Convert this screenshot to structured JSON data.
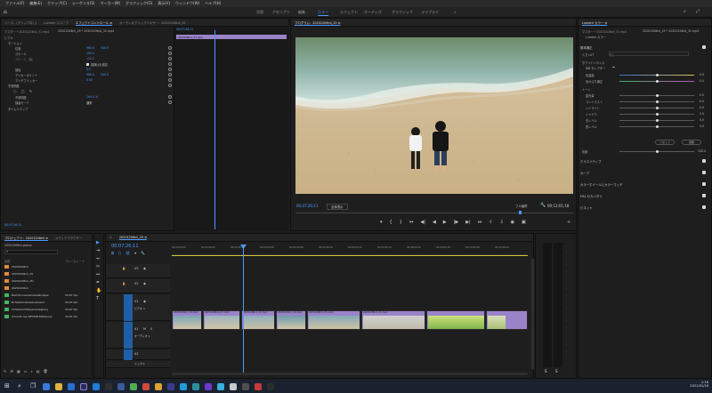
{
  "menu": [
    "ファイル(F)",
    "編集(E)",
    "クリップ(C)",
    "シーケンス(S)",
    "マーカー(M)",
    "グラフィック(G)",
    "表示(V)",
    "ウィンドウ(W)",
    "ヘルプ(H)"
  ],
  "workspaces": [
    "学習",
    "アセンブリ",
    "編集",
    "カラー",
    "エフェクト",
    "オーディオ",
    "グラフィック",
    "ライブラリ"
  ],
  "active_workspace": "カラー",
  "source_tabs": [
    "ソース：(クリップなし)",
    "Lumetri スコープ",
    "エフェクトコントロール ≡",
    "オーディオクリップミキサー：20201206nii_25"
  ],
  "effect_controls": {
    "header_left": "マスター * 20201206nii_31.mp4",
    "header_right": "20201206nii_25 * 20201206nii_31.mp4",
    "section_video": "ビデオ",
    "motion": "モーション",
    "rows": [
      {
        "label": "位置",
        "val1": "960.0",
        "val2": "540.0"
      },
      {
        "label": "スケール",
        "val1": "100.0",
        "val2": ""
      },
      {
        "label": "スケール（幅）",
        "val1": "100.0",
        "val2": ""
      },
      {
        "label": "",
        "val1": "",
        "val2": "縦横比を固定"
      },
      {
        "label": "回転",
        "val1": "0.0",
        "val2": ""
      },
      {
        "label": "アンカーポイント",
        "val1": "960.0",
        "val2": "540.0"
      },
      {
        "label": "アンチフリッカー",
        "val1": "0.00",
        "val2": ""
      }
    ],
    "opacity": "不透明度",
    "opacity_val": "100.0 %",
    "blend_label": "描画モード",
    "blend_val": "通常",
    "timeremap": "タイムリマップ",
    "tc_mini": "00;07;26;11",
    "clip_name": "20201206nii_31.mp4"
  },
  "program": {
    "tab": "プログラム：20201206nii_25 ≡",
    "timecode": "00;07;26;11",
    "fit": "全体表示",
    "quality": "フル画質",
    "duration": "00;12;01;18",
    "controls": [
      "⏮",
      "◀|",
      "◀",
      "▶",
      "|▶",
      "▶|",
      "⏭"
    ]
  },
  "lumetri": {
    "tab": "Lumetri カラー ≡",
    "header_left": "マスター * 20201206nii_31.mp4",
    "header_right": "20201206nii_25 * 20201206nii_31.mp4",
    "preset": "Lumetri カラー",
    "basic": "基本補正",
    "input_lut_label": "入力 LUT",
    "input_lut_val": "なし",
    "wb_label": "ホワイトバランス",
    "wb_picker": "WB セレクター",
    "temp_label": "色温度",
    "temp_val": "0.0",
    "tint_label": "色かぶり補正",
    "tint_val": "0.0",
    "tone_label": "トーン",
    "tone_rows": [
      {
        "label": "露光量",
        "val": "0.0"
      },
      {
        "label": "コントラスト",
        "val": "0.0"
      },
      {
        "label": "ハイライト",
        "val": "0.0"
      },
      {
        "label": "シャドウ",
        "val": "0.0"
      },
      {
        "label": "白レベル",
        "val": "0.0"
      },
      {
        "label": "黒レベル",
        "val": "0.0"
      }
    ],
    "reset_btn": "リセット",
    "auto_btn": "自動",
    "sat_label": "彩度",
    "sat_val": "100.0",
    "sections": [
      "クリエイティブ",
      "カーブ",
      "カラーホイールとカラーマッチ",
      "HSL セカンダリ",
      "ビネット"
    ]
  },
  "project": {
    "tab": "プロジェクト：20201206nii ≡",
    "tab2": "メディアブラウザー",
    "file": "20201206nii.prproj",
    "col_name": "名前",
    "col_fps": "フレームレート",
    "items": [
      {
        "name": "20201206nii",
        "fps": "",
        "color": "#e08a3a"
      },
      {
        "name": "20201206nii_25",
        "fps": "",
        "color": "#e08a3a"
      },
      {
        "name": "20201206nii_sfx",
        "fps": "",
        "color": "#e08a3a"
      },
      {
        "name": "20201206nii",
        "fps": "",
        "color": "#e08a3a"
      },
      {
        "name": "BachScoreanimoleetkostjee",
        "fps": "29.97 fps",
        "color": "#3fb55f"
      },
      {
        "name": "Bchaiahanslaisenaheard",
        "fps": "29.97 fps",
        "color": "#3fb55f"
      },
      {
        "name": "Chisotsamtikujanemaghery",
        "fps": "29.97 fps",
        "color": "#3fb55f"
      },
      {
        "name": "Schooth las 2854SB-Mtlinjouls",
        "fps": "29.97 fps",
        "color": "#3fb55f"
      }
    ]
  },
  "timeline": {
    "tab": "20201206nii_25 ≡",
    "timecode": "00;07;26;11",
    "ruler": [
      "00;00;00;00",
      "00;01;00;02",
      "00;02;00;04",
      "00;03;00;06",
      "00;04;00;08",
      "00;05;00;10",
      "00;06;00;12",
      "00;07;00;14",
      "00;08;00;16",
      "00;09;00;18",
      "00;10;00;20",
      "00;11;00;22"
    ],
    "tracks": [
      "V3",
      "V2",
      "V1",
      "A1",
      "A2",
      "A3"
    ],
    "clip_labels": [
      "20201206nii_01.mp4",
      "20201206nii_07.mp4",
      "20201206nii_13.mp4",
      "20201206nii_19.mp4",
      "20201206nii_25.mp4",
      "20201206nii_31.mp4"
    ],
    "video_label": "ビデオ 1",
    "audio_label": "オーディオ 1",
    "master": "ミックス"
  },
  "taskbar": {
    "time": "1:16",
    "date": "2021/01/18"
  }
}
